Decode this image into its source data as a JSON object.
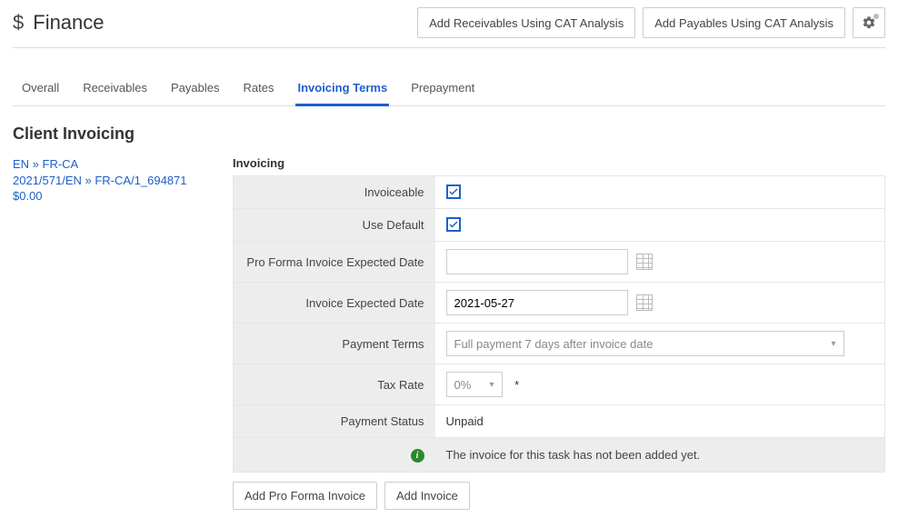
{
  "header": {
    "title": "Finance",
    "btn_receivables": "Add Receivables Using CAT Analysis",
    "btn_payables": "Add Payables Using CAT Analysis"
  },
  "tabs": {
    "overall": "Overall",
    "receivables": "Receivables",
    "payables": "Payables",
    "rates": "Rates",
    "invoicing_terms": "Invoicing Terms",
    "prepayment": "Prepayment"
  },
  "section_title": "Client Invoicing",
  "sidebar": {
    "lang_pair": "EN » FR-CA",
    "task_ref": "2021/571/EN » FR-CA/1_694871",
    "amount": "$0.00"
  },
  "form": {
    "heading": "Invoicing",
    "labels": {
      "invoiceable": "Invoiceable",
      "use_default": "Use Default",
      "pro_forma_date": "Pro Forma Invoice Expected Date",
      "invoice_date": "Invoice Expected Date",
      "payment_terms": "Payment Terms",
      "tax_rate": "Tax Rate",
      "payment_status": "Payment Status"
    },
    "values": {
      "pro_forma_date": "",
      "invoice_date": "2021-05-27",
      "payment_terms": "Full payment 7 days after invoice date",
      "tax_rate": "0%",
      "payment_status": "Unpaid",
      "info_message": "The invoice for this task has not been added yet."
    }
  },
  "footer": {
    "add_pro_forma": "Add Pro Forma Invoice",
    "add_invoice": "Add Invoice"
  }
}
